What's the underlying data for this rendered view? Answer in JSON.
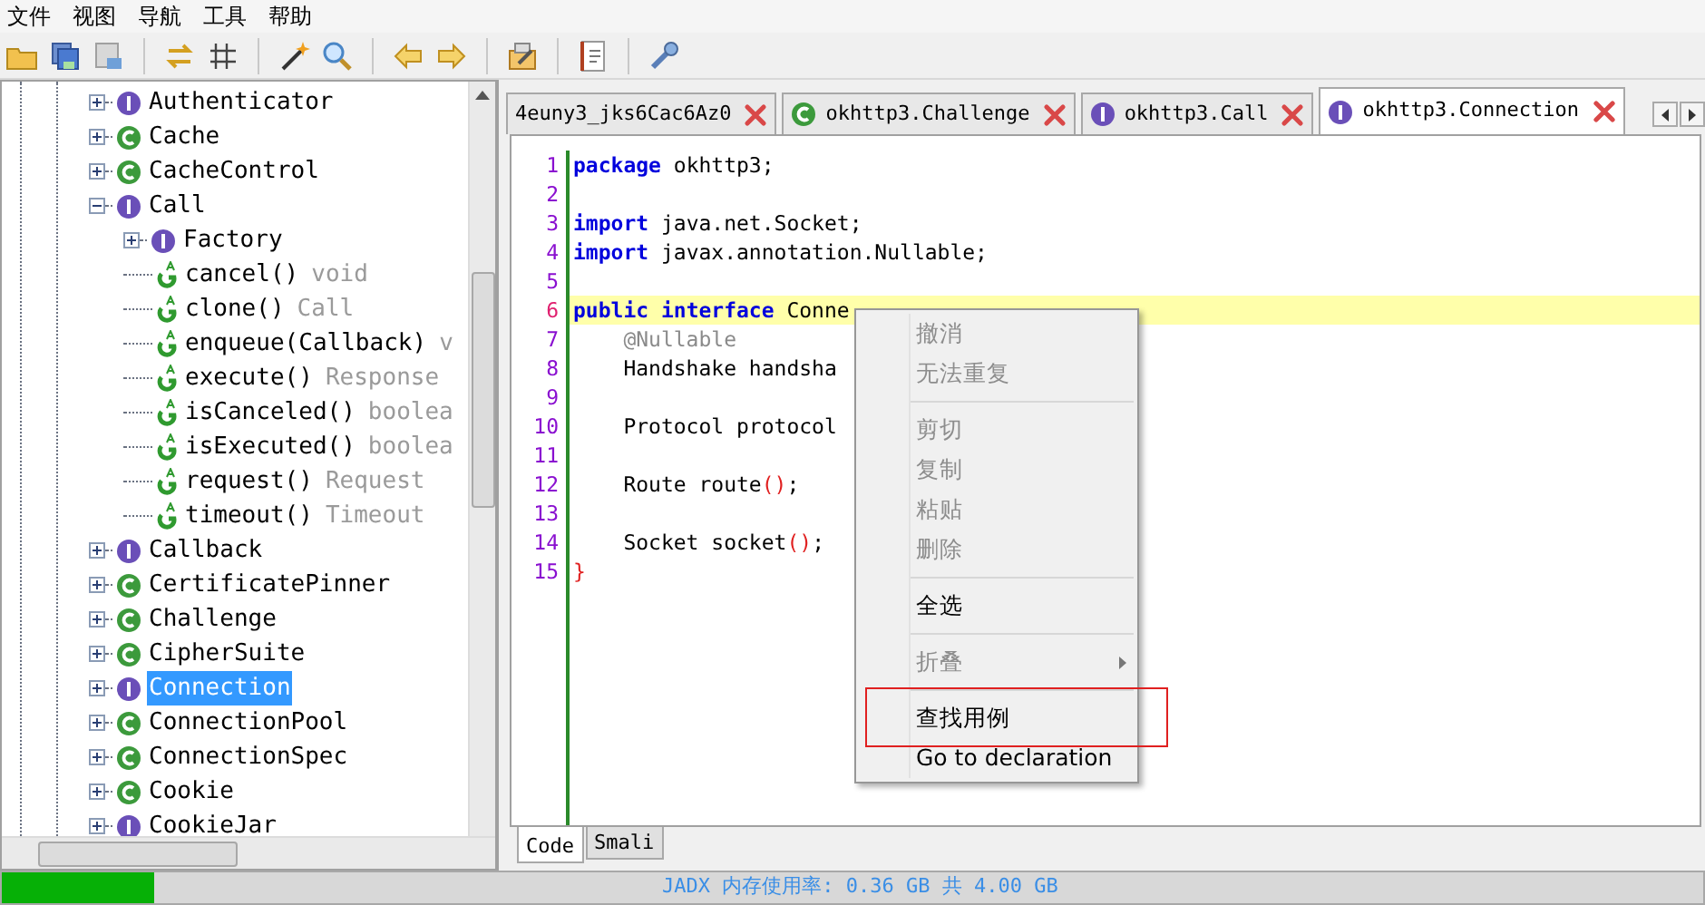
{
  "menu_bar": [
    "文件",
    "视图",
    "导航",
    "工具",
    "帮助"
  ],
  "tree": [
    {
      "kind": "interface",
      "label": "Authenticator",
      "expanded": false,
      "selected": false
    },
    {
      "kind": "class",
      "label": "Cache",
      "expanded": false,
      "selected": false
    },
    {
      "kind": "class",
      "label": "CacheControl",
      "expanded": false,
      "selected": false
    },
    {
      "kind": "interface",
      "label": "Call",
      "expanded": true,
      "selected": false,
      "children": [
        {
          "kind": "interface",
          "label": "Factory",
          "expanded": false,
          "selected": false
        },
        {
          "kind": "method",
          "label": "cancel()",
          "type": "void",
          "selected": false
        },
        {
          "kind": "method",
          "label": "clone()",
          "type": "Call",
          "selected": false
        },
        {
          "kind": "method",
          "label": "enqueue(Callback)",
          "type": "v",
          "selected": false
        },
        {
          "kind": "method",
          "label": "execute()",
          "type": "Response",
          "selected": false
        },
        {
          "kind": "method",
          "label": "isCanceled()",
          "type": "boolea",
          "selected": false
        },
        {
          "kind": "method",
          "label": "isExecuted()",
          "type": "boolea",
          "selected": false
        },
        {
          "kind": "method",
          "label": "request()",
          "type": "Request",
          "selected": false
        },
        {
          "kind": "method",
          "label": "timeout()",
          "type": "Timeout",
          "selected": false
        }
      ]
    },
    {
      "kind": "interface",
      "label": "Callback",
      "expanded": false,
      "selected": false
    },
    {
      "kind": "class",
      "label": "CertificatePinner",
      "expanded": false,
      "selected": false
    },
    {
      "kind": "class",
      "label": "Challenge",
      "expanded": false,
      "selected": false
    },
    {
      "kind": "class",
      "label": "CipherSuite",
      "expanded": false,
      "selected": false
    },
    {
      "kind": "interface",
      "label": "Connection",
      "expanded": false,
      "selected": true
    },
    {
      "kind": "class",
      "label": "ConnectionPool",
      "expanded": false,
      "selected": false
    },
    {
      "kind": "class",
      "label": "ConnectionSpec",
      "expanded": false,
      "selected": false
    },
    {
      "kind": "class",
      "label": "Cookie",
      "expanded": false,
      "selected": false
    },
    {
      "kind": "interface",
      "label": "CookieJar",
      "expanded": false,
      "selected": false
    }
  ],
  "tabs": [
    {
      "kind": "none",
      "label": "4euny3_jks6Cac6Az0",
      "selected": false
    },
    {
      "kind": "class",
      "label": "okhttp3.Challenge",
      "selected": false
    },
    {
      "kind": "interface",
      "label": "okhttp3.Call",
      "selected": false
    },
    {
      "kind": "interface",
      "label": "okhttp3.Connection",
      "selected": true
    }
  ],
  "code_lines": [
    {
      "number": "1",
      "current": false,
      "tokens": [
        {
          "kind": "keyword",
          "text": "package"
        },
        {
          "kind": "plain",
          "text": " okhttp3;"
        }
      ]
    },
    {
      "number": "2",
      "current": false
    },
    {
      "number": "3",
      "current": false,
      "tokens": [
        {
          "kind": "keyword",
          "text": "import"
        },
        {
          "kind": "plain",
          "text": " java.net.Socket;"
        }
      ]
    },
    {
      "number": "4",
      "current": false,
      "tokens": [
        {
          "kind": "keyword",
          "text": "import"
        },
        {
          "kind": "plain",
          "text": " javax.annotation.Nullable;"
        }
      ]
    },
    {
      "number": "5",
      "current": false
    },
    {
      "number": "6",
      "current": true,
      "tokens": [
        {
          "kind": "keyword",
          "text": "public "
        },
        {
          "kind": "keyword",
          "text": "interface"
        },
        {
          "kind": "plain",
          "text": " Conne"
        }
      ]
    },
    {
      "number": "7",
      "current": false,
      "tokens": [
        {
          "kind": "annotation",
          "text": "    @Nullable"
        }
      ]
    },
    {
      "number": "8",
      "current": false,
      "tokens": [
        {
          "kind": "plain",
          "text": "    Handshake handsha"
        }
      ]
    },
    {
      "number": "9",
      "current": false
    },
    {
      "number": "10",
      "current": false,
      "tokens": [
        {
          "kind": "plain",
          "text": "    Protocol protocol"
        }
      ]
    },
    {
      "number": "11",
      "current": false
    },
    {
      "number": "12",
      "current": false,
      "tokens": [
        {
          "kind": "plain",
          "text": "    Route route"
        },
        {
          "kind": "paren",
          "text": "()"
        },
        {
          "kind": "plain",
          "text": ";"
        }
      ]
    },
    {
      "number": "13",
      "current": false
    },
    {
      "number": "14",
      "current": false,
      "tokens": [
        {
          "kind": "plain",
          "text": "    Socket socket"
        },
        {
          "kind": "paren",
          "text": "()"
        },
        {
          "kind": "plain",
          "text": ";"
        }
      ]
    },
    {
      "number": "15",
      "current": false,
      "tokens": [
        {
          "kind": "paren",
          "text": "}"
        }
      ]
    }
  ],
  "context_menu": [
    {
      "kind": "item",
      "label": "撤消",
      "disabled": true
    },
    {
      "kind": "item",
      "label": "无法重复",
      "disabled": true
    },
    {
      "kind": "separator"
    },
    {
      "kind": "item",
      "label": "剪切",
      "disabled": true
    },
    {
      "kind": "item",
      "label": "复制",
      "disabled": true
    },
    {
      "kind": "item",
      "label": "粘贴",
      "disabled": true
    },
    {
      "kind": "item",
      "label": "删除",
      "disabled": true
    },
    {
      "kind": "separator"
    },
    {
      "kind": "item",
      "label": "全选",
      "disabled": false
    },
    {
      "kind": "separator"
    },
    {
      "kind": "submenu",
      "label": "折叠",
      "disabled": true
    },
    {
      "kind": "separator"
    },
    {
      "kind": "item",
      "label": "查找用例",
      "disabled": false,
      "marked": true
    },
    {
      "kind": "item",
      "label": "Go to declaration",
      "disabled": false
    }
  ],
  "bottom_tabs": [
    {
      "label": "Code",
      "selected": true
    },
    {
      "label": "Smali",
      "selected": false
    }
  ],
  "status_bar": {
    "text": "JADX 内存使用率: 0.36 GB 共 4.00 GB",
    "level": 0.09
  }
}
